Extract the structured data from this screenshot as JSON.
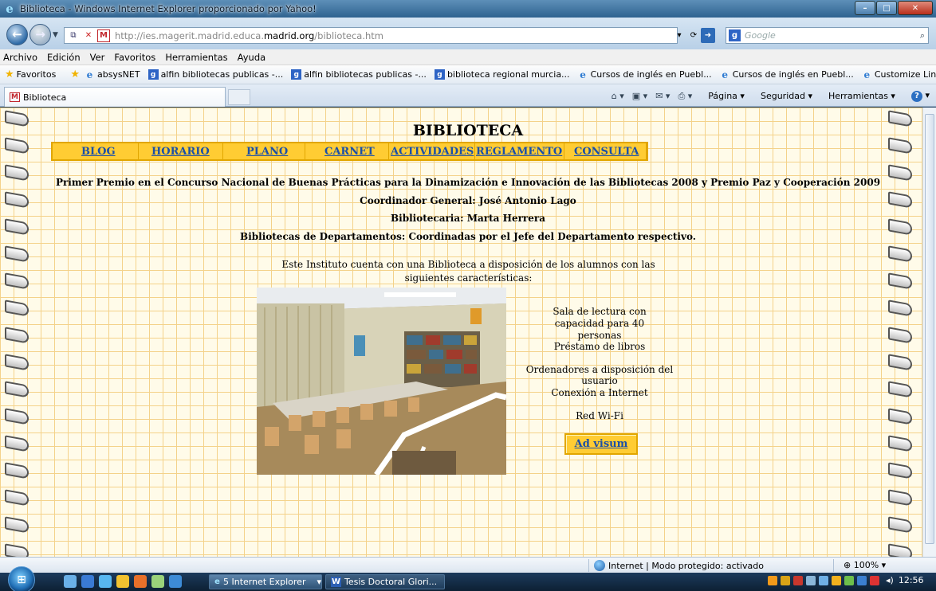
{
  "window": {
    "title": "Biblioteca - Windows Internet Explorer proporcionado por Yahoo!"
  },
  "addressbar": {
    "url_prefix": "http://ies.magerit.madrid.educa.",
    "url_domain": "madrid.org",
    "url_suffix": "/biblioteca.htm",
    "search_placeholder": "Google"
  },
  "menu": [
    "Archivo",
    "Edición",
    "Ver",
    "Favoritos",
    "Herramientas",
    "Ayuda"
  ],
  "favorites": {
    "label": "Favoritos",
    "items": [
      {
        "label": "absysNET",
        "icon": "ie-page-icon"
      },
      {
        "label": "alfin bibliotecas publicas -...",
        "icon": "google-icon"
      },
      {
        "label": "alfin bibliotecas publicas -...",
        "icon": "google-icon"
      },
      {
        "label": "biblioteca regional murcia...",
        "icon": "google-icon"
      },
      {
        "label": "Cursos de inglés en Puebl...",
        "icon": "ie-page-icon"
      },
      {
        "label": "Cursos de inglés en Puebl...",
        "icon": "ie-page-icon"
      },
      {
        "label": "Customize Links",
        "icon": "ie-page-icon"
      }
    ]
  },
  "tabs": {
    "active_label": "Biblioteca"
  },
  "commandbar": {
    "page": "Página",
    "security": "Seguridad",
    "tools": "Herramientas"
  },
  "page": {
    "title": "BIBLIOTECA",
    "nav": [
      "BLOG",
      "HORARIO",
      "PLANO",
      "CARNET",
      "ACTIVIDADES",
      "REGLAMENTO",
      "CONSULTA"
    ],
    "award": "Primer Premio en el Concurso Nacional de Buenas Prácticas para la Dinamización e Innovación de las Bibliotecas 2008 y Premio Paz y Cooperación 2009",
    "coordinator": "Coordinador General:  José Antonio Lago",
    "librarian": "Bibliotecaria:  Marta Herrera",
    "departments": "Bibliotecas de Departamentos: Coordinadas por el Jefe del Departamento respectivo.",
    "intro": "Este Instituto cuenta con una Biblioteca a disposición de los alumnos con las siguientes características:",
    "features": [
      "Sala de lectura con capacidad para 40 personas",
      "Préstamo de libros",
      "Ordenadores a disposición del usuario",
      "Conexión a Internet",
      "Red Wi-Fi"
    ],
    "ad_button": "Ad visum"
  },
  "statusbar": {
    "zone": "Internet | Modo protegido: activado",
    "zoom": "100%"
  },
  "taskbar": {
    "items": [
      "5 Internet Explorer",
      "Tesis Doctoral Glori..."
    ],
    "clock": "12:56"
  },
  "colors": {
    "nav_bg": "#ffcc33",
    "nav_link": "#1a4fa8",
    "grid_line": "#f4d28a",
    "page_bg": "#fffbe9"
  }
}
